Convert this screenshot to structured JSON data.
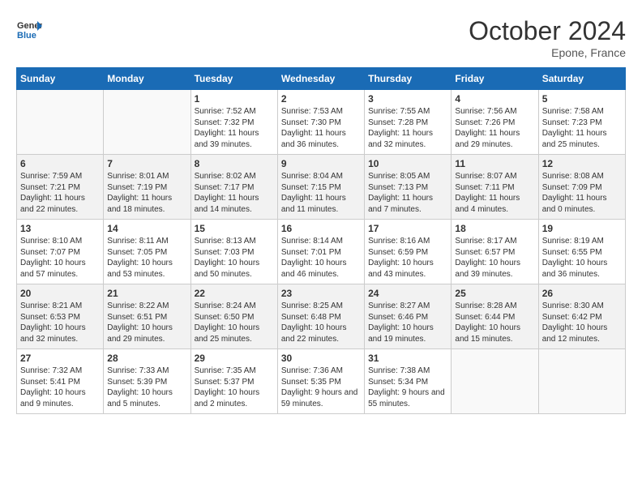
{
  "header": {
    "logo_line1": "General",
    "logo_line2": "Blue",
    "month_year": "October 2024",
    "location": "Epone, France"
  },
  "days_of_week": [
    "Sunday",
    "Monday",
    "Tuesday",
    "Wednesday",
    "Thursday",
    "Friday",
    "Saturday"
  ],
  "weeks": [
    [
      {
        "day": "",
        "sunrise": "",
        "sunset": "",
        "daylight": ""
      },
      {
        "day": "",
        "sunrise": "",
        "sunset": "",
        "daylight": ""
      },
      {
        "day": "1",
        "sunrise": "Sunrise: 7:52 AM",
        "sunset": "Sunset: 7:32 PM",
        "daylight": "Daylight: 11 hours and 39 minutes."
      },
      {
        "day": "2",
        "sunrise": "Sunrise: 7:53 AM",
        "sunset": "Sunset: 7:30 PM",
        "daylight": "Daylight: 11 hours and 36 minutes."
      },
      {
        "day": "3",
        "sunrise": "Sunrise: 7:55 AM",
        "sunset": "Sunset: 7:28 PM",
        "daylight": "Daylight: 11 hours and 32 minutes."
      },
      {
        "day": "4",
        "sunrise": "Sunrise: 7:56 AM",
        "sunset": "Sunset: 7:26 PM",
        "daylight": "Daylight: 11 hours and 29 minutes."
      },
      {
        "day": "5",
        "sunrise": "Sunrise: 7:58 AM",
        "sunset": "Sunset: 7:23 PM",
        "daylight": "Daylight: 11 hours and 25 minutes."
      }
    ],
    [
      {
        "day": "6",
        "sunrise": "Sunrise: 7:59 AM",
        "sunset": "Sunset: 7:21 PM",
        "daylight": "Daylight: 11 hours and 22 minutes."
      },
      {
        "day": "7",
        "sunrise": "Sunrise: 8:01 AM",
        "sunset": "Sunset: 7:19 PM",
        "daylight": "Daylight: 11 hours and 18 minutes."
      },
      {
        "day": "8",
        "sunrise": "Sunrise: 8:02 AM",
        "sunset": "Sunset: 7:17 PM",
        "daylight": "Daylight: 11 hours and 14 minutes."
      },
      {
        "day": "9",
        "sunrise": "Sunrise: 8:04 AM",
        "sunset": "Sunset: 7:15 PM",
        "daylight": "Daylight: 11 hours and 11 minutes."
      },
      {
        "day": "10",
        "sunrise": "Sunrise: 8:05 AM",
        "sunset": "Sunset: 7:13 PM",
        "daylight": "Daylight: 11 hours and 7 minutes."
      },
      {
        "day": "11",
        "sunrise": "Sunrise: 8:07 AM",
        "sunset": "Sunset: 7:11 PM",
        "daylight": "Daylight: 11 hours and 4 minutes."
      },
      {
        "day": "12",
        "sunrise": "Sunrise: 8:08 AM",
        "sunset": "Sunset: 7:09 PM",
        "daylight": "Daylight: 11 hours and 0 minutes."
      }
    ],
    [
      {
        "day": "13",
        "sunrise": "Sunrise: 8:10 AM",
        "sunset": "Sunset: 7:07 PM",
        "daylight": "Daylight: 10 hours and 57 minutes."
      },
      {
        "day": "14",
        "sunrise": "Sunrise: 8:11 AM",
        "sunset": "Sunset: 7:05 PM",
        "daylight": "Daylight: 10 hours and 53 minutes."
      },
      {
        "day": "15",
        "sunrise": "Sunrise: 8:13 AM",
        "sunset": "Sunset: 7:03 PM",
        "daylight": "Daylight: 10 hours and 50 minutes."
      },
      {
        "day": "16",
        "sunrise": "Sunrise: 8:14 AM",
        "sunset": "Sunset: 7:01 PM",
        "daylight": "Daylight: 10 hours and 46 minutes."
      },
      {
        "day": "17",
        "sunrise": "Sunrise: 8:16 AM",
        "sunset": "Sunset: 6:59 PM",
        "daylight": "Daylight: 10 hours and 43 minutes."
      },
      {
        "day": "18",
        "sunrise": "Sunrise: 8:17 AM",
        "sunset": "Sunset: 6:57 PM",
        "daylight": "Daylight: 10 hours and 39 minutes."
      },
      {
        "day": "19",
        "sunrise": "Sunrise: 8:19 AM",
        "sunset": "Sunset: 6:55 PM",
        "daylight": "Daylight: 10 hours and 36 minutes."
      }
    ],
    [
      {
        "day": "20",
        "sunrise": "Sunrise: 8:21 AM",
        "sunset": "Sunset: 6:53 PM",
        "daylight": "Daylight: 10 hours and 32 minutes."
      },
      {
        "day": "21",
        "sunrise": "Sunrise: 8:22 AM",
        "sunset": "Sunset: 6:51 PM",
        "daylight": "Daylight: 10 hours and 29 minutes."
      },
      {
        "day": "22",
        "sunrise": "Sunrise: 8:24 AM",
        "sunset": "Sunset: 6:50 PM",
        "daylight": "Daylight: 10 hours and 25 minutes."
      },
      {
        "day": "23",
        "sunrise": "Sunrise: 8:25 AM",
        "sunset": "Sunset: 6:48 PM",
        "daylight": "Daylight: 10 hours and 22 minutes."
      },
      {
        "day": "24",
        "sunrise": "Sunrise: 8:27 AM",
        "sunset": "Sunset: 6:46 PM",
        "daylight": "Daylight: 10 hours and 19 minutes."
      },
      {
        "day": "25",
        "sunrise": "Sunrise: 8:28 AM",
        "sunset": "Sunset: 6:44 PM",
        "daylight": "Daylight: 10 hours and 15 minutes."
      },
      {
        "day": "26",
        "sunrise": "Sunrise: 8:30 AM",
        "sunset": "Sunset: 6:42 PM",
        "daylight": "Daylight: 10 hours and 12 minutes."
      }
    ],
    [
      {
        "day": "27",
        "sunrise": "Sunrise: 7:32 AM",
        "sunset": "Sunset: 5:41 PM",
        "daylight": "Daylight: 10 hours and 9 minutes."
      },
      {
        "day": "28",
        "sunrise": "Sunrise: 7:33 AM",
        "sunset": "Sunset: 5:39 PM",
        "daylight": "Daylight: 10 hours and 5 minutes."
      },
      {
        "day": "29",
        "sunrise": "Sunrise: 7:35 AM",
        "sunset": "Sunset: 5:37 PM",
        "daylight": "Daylight: 10 hours and 2 minutes."
      },
      {
        "day": "30",
        "sunrise": "Sunrise: 7:36 AM",
        "sunset": "Sunset: 5:35 PM",
        "daylight": "Daylight: 9 hours and 59 minutes."
      },
      {
        "day": "31",
        "sunrise": "Sunrise: 7:38 AM",
        "sunset": "Sunset: 5:34 PM",
        "daylight": "Daylight: 9 hours and 55 minutes."
      },
      {
        "day": "",
        "sunrise": "",
        "sunset": "",
        "daylight": ""
      },
      {
        "day": "",
        "sunrise": "",
        "sunset": "",
        "daylight": ""
      }
    ]
  ]
}
